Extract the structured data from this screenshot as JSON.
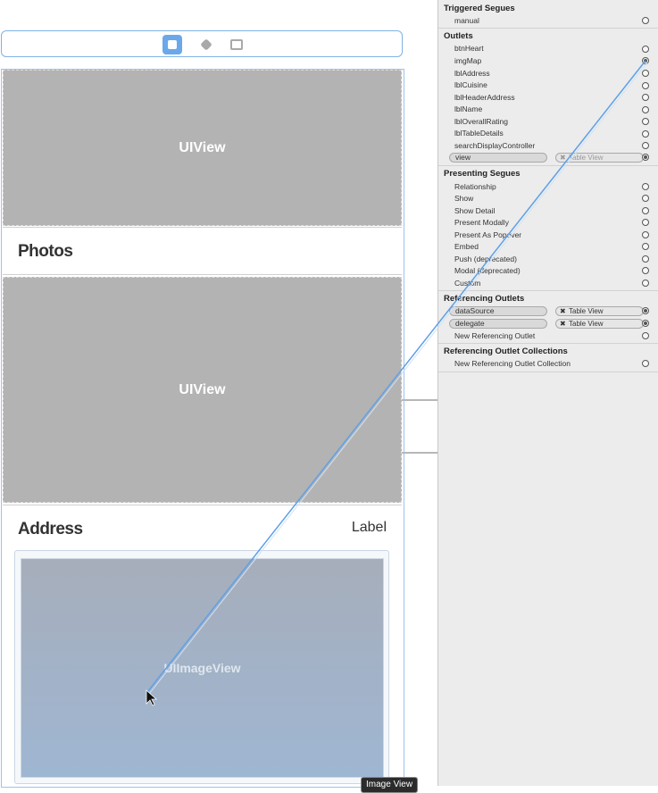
{
  "canvas": {
    "upper_view_label": "UIView",
    "photos_title": "Photos",
    "lower_view_label": "UIView",
    "address_title": "Address",
    "address_label": "Label",
    "image_view_label": "UIImageView",
    "tooltip": "Image View"
  },
  "inspector": {
    "triggered_segues": {
      "title": "Triggered Segues",
      "items": [
        "manual"
      ]
    },
    "outlets": {
      "title": "Outlets",
      "items": [
        "btnHeart",
        "imgMap",
        "lblAddress",
        "lblCuisine",
        "lblHeaderAddress",
        "lblName",
        "lblOverallRating",
        "lblTableDetails",
        "searchDisplayController"
      ],
      "connected": {
        "name": "view",
        "target": "Table View"
      }
    },
    "presenting_segues": {
      "title": "Presenting Segues",
      "items": [
        "Relationship",
        "Show",
        "Show Detail",
        "Present Modally",
        "Present As Popover",
        "Embed",
        "Push (deprecated)",
        "Modal (deprecated)",
        "Custom"
      ]
    },
    "referencing_outlets": {
      "title": "Referencing Outlets",
      "connections": [
        {
          "name": "dataSource",
          "target": "Table View"
        },
        {
          "name": "delegate",
          "target": "Table View"
        }
      ],
      "new_item": "New Referencing Outlet"
    },
    "referencing_outlet_collections": {
      "title": "Referencing Outlet Collections",
      "new_item": "New Referencing Outlet Collection"
    }
  },
  "colors": {
    "selection_blue": "#6aa8ea",
    "connection_line": "#5fa0e6",
    "placeholder_gray": "#b3b3b3"
  }
}
